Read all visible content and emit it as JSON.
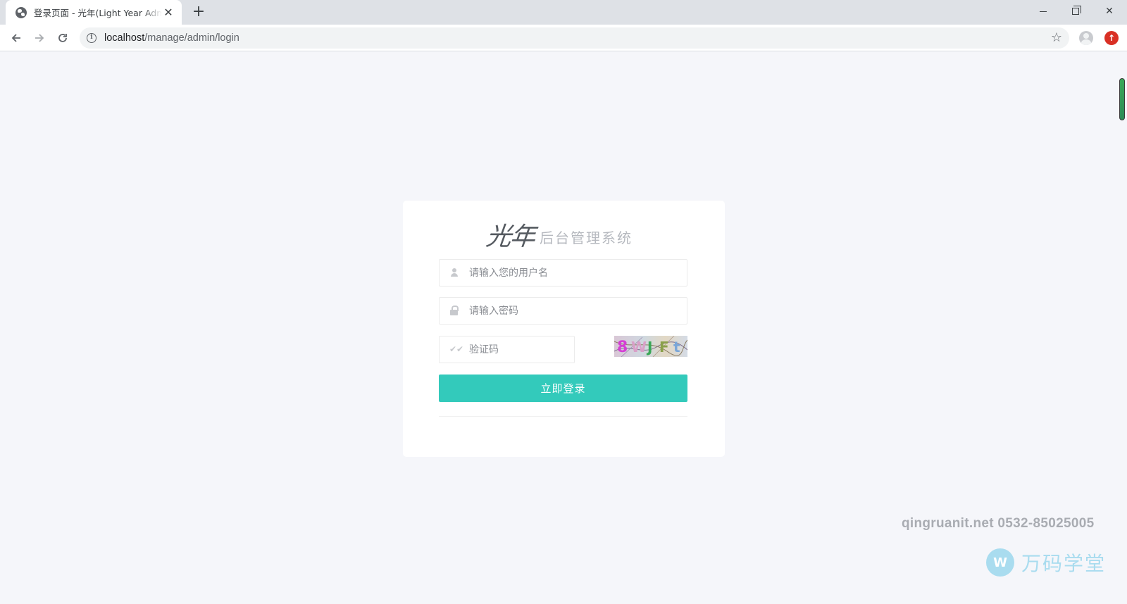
{
  "browser": {
    "tab_title": "登录页面 - 光年(Light Year Admin)",
    "url_host": "localhost",
    "url_path": "/manage/admin/login"
  },
  "login": {
    "logo_mark": "光年",
    "logo_text": "后台管理系统",
    "username_placeholder": "请输入您的用户名",
    "password_placeholder": "请输入密码",
    "captcha_placeholder": "验证码",
    "captcha_text": "8WJFt",
    "submit_label": "立即登录"
  },
  "watermark": {
    "contact": "qingruanit.net 0532-85025005",
    "brand_name": "万码学堂",
    "brand_colors": {
      "text": "#a9dcef",
      "contact": "#a9acb2"
    }
  },
  "colors": {
    "accent": "#33cabb",
    "page_bg": "#f5f6fa",
    "card_bg": "#ffffff"
  },
  "icons": {
    "favicon": "globe-icon",
    "username": "user-icon",
    "password": "lock-icon",
    "captcha": "check-icon",
    "bookmark": "star-icon"
  }
}
